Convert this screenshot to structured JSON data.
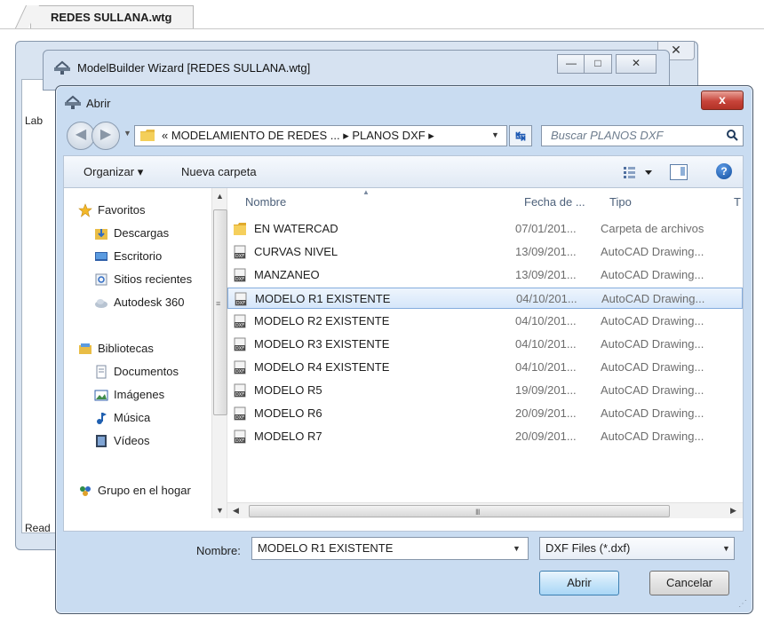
{
  "doc_tab": {
    "title": "REDES SULLANA.wtg"
  },
  "back_window": {
    "side_label": "Lab",
    "status_label": "Read",
    "close_glyph": "✕"
  },
  "wizard_window": {
    "title": "ModelBuilder Wizard [REDES SULLANA.wtg]",
    "min_glyph": "—",
    "max_glyph": "□",
    "close_glyph": "✕"
  },
  "dialog": {
    "title": "Abrir",
    "close_glyph": "x",
    "address": "« MODELAMIENTO DE REDES ...  ▸  PLANOS DXF  ▸",
    "search_placeholder": "Buscar PLANOS DXF",
    "toolbar": {
      "organize": "Organizar ▾",
      "new_folder": "Nueva carpeta",
      "help": "?"
    },
    "nav": {
      "favorites_header": "Favoritos",
      "favorites": [
        "Descargas",
        "Escritorio",
        "Sitios recientes",
        "Autodesk 360"
      ],
      "libraries_header": "Bibliotecas",
      "libraries": [
        "Documentos",
        "Imágenes",
        "Música",
        "Vídeos"
      ],
      "homegroup": "Grupo en el hogar"
    },
    "columns": {
      "name": "Nombre",
      "date": "Fecha de ...",
      "type": "Tipo",
      "extra": "T"
    },
    "files": [
      {
        "name": "EN WATERCAD",
        "date": "07/01/201...",
        "type": "Carpeta de archivos",
        "icon": "folder-icon"
      },
      {
        "name": "CURVAS NIVEL",
        "date": "13/09/201...",
        "type": "AutoCAD Drawing...",
        "icon": "dxf-file-icon"
      },
      {
        "name": "MANZANEO",
        "date": "13/09/201...",
        "type": "AutoCAD Drawing...",
        "icon": "dxf-file-icon"
      },
      {
        "name": "MODELO R1 EXISTENTE",
        "date": "04/10/201...",
        "type": "AutoCAD Drawing...",
        "icon": "dxf-file-icon",
        "selected": true
      },
      {
        "name": "MODELO R2 EXISTENTE",
        "date": "04/10/201...",
        "type": "AutoCAD Drawing...",
        "icon": "dxf-file-icon"
      },
      {
        "name": "MODELO R3 EXISTENTE",
        "date": "04/10/201...",
        "type": "AutoCAD Drawing...",
        "icon": "dxf-file-icon"
      },
      {
        "name": "MODELO R4 EXISTENTE",
        "date": "04/10/201...",
        "type": "AutoCAD Drawing...",
        "icon": "dxf-file-icon"
      },
      {
        "name": "MODELO R5",
        "date": "19/09/201...",
        "type": "AutoCAD Drawing...",
        "icon": "dxf-file-icon"
      },
      {
        "name": "MODELO R6",
        "date": "20/09/201...",
        "type": "AutoCAD Drawing...",
        "icon": "dxf-file-icon"
      },
      {
        "name": "MODELO R7",
        "date": "20/09/201...",
        "type": "AutoCAD Drawing...",
        "icon": "dxf-file-icon"
      }
    ],
    "filename_label": "Nombre:",
    "filename_value": "MODELO R1 EXISTENTE",
    "filter_value": "DXF Files (*.dxf)",
    "open_button": "Abrir",
    "cancel_button": "Cancelar",
    "scroll_grip": "III"
  },
  "colors": {
    "dialog_chrome": "#c9dcf1",
    "selection_bg": "#d5e6fa",
    "selection_border": "#84acdd",
    "close_red": "#c7443a",
    "link_blue": "#1e3f6e"
  }
}
